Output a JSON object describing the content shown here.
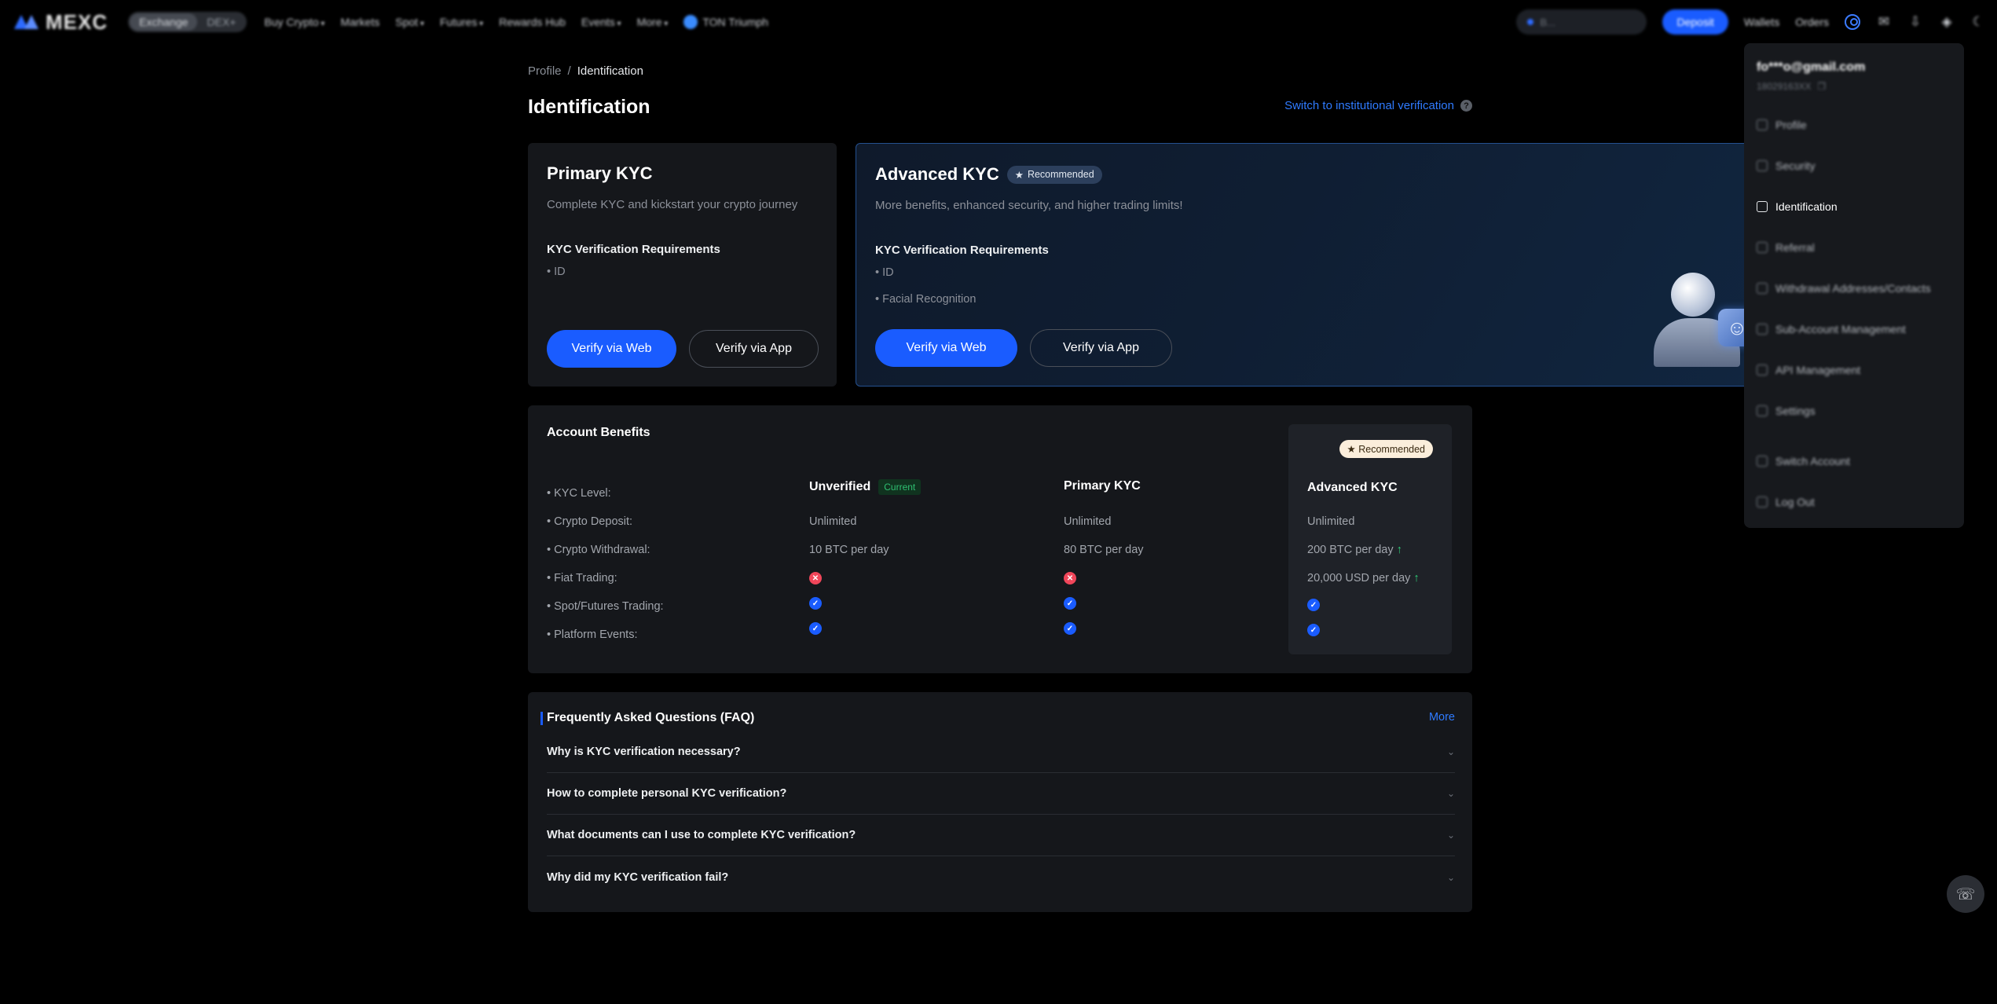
{
  "nav": {
    "logo": "MEXC",
    "segments": [
      "Exchange",
      "DEX+"
    ],
    "items": [
      "Buy Crypto",
      "Markets",
      "Spot",
      "Futures",
      "Rewards Hub",
      "Events",
      "More"
    ],
    "ton": "TON Triumph",
    "search_placeholder": "B...",
    "deposit": "Deposit",
    "wallets": "Wallets",
    "orders": "Orders"
  },
  "breadcrumb": {
    "parent": "Profile",
    "separator": "/",
    "current": "Identification"
  },
  "page_title": "Identification",
  "institutional_link": "Switch to institutional verification",
  "primary": {
    "title": "Primary KYC",
    "desc": "Complete KYC and kickstart your crypto journey",
    "req_title": "KYC Verification Requirements",
    "reqs": [
      "• ID"
    ],
    "verify_web": "Verify via Web",
    "verify_app": "Verify via App"
  },
  "advanced": {
    "title": "Advanced KYC",
    "badge": "Recommended",
    "desc": "More benefits, enhanced security, and higher trading limits!",
    "req_title": "KYC Verification Requirements",
    "reqs": [
      "• ID",
      "• Facial Recognition"
    ],
    "verify_web": "Verify via Web",
    "verify_app": "Verify via App"
  },
  "benefits": {
    "title": "Account Benefits",
    "rows": [
      "• KYC Level:",
      "• Crypto Deposit:",
      "• Crypto Withdrawal:",
      "• Fiat Trading:",
      "• Spot/Futures Trading:",
      "• Platform Events:"
    ],
    "unverified": {
      "title": "Unverified",
      "current": "Current",
      "deposit": "Unlimited",
      "withdrawal": "10 BTC per day",
      "fiat": "x",
      "spot": "check",
      "events": "check"
    },
    "primary": {
      "title": "Primary KYC",
      "deposit": "Unlimited",
      "withdrawal": "80 BTC per day",
      "fiat": "x",
      "spot": "check",
      "events": "check"
    },
    "advanced": {
      "badge": "Recommended",
      "title": "Advanced KYC",
      "deposit": "Unlimited",
      "withdrawal": "200 BTC per day",
      "fiat": "20,000 USD per day",
      "spot": "check",
      "events": "check"
    }
  },
  "faq": {
    "title": "Frequently Asked Questions (FAQ)",
    "more": "More",
    "questions": [
      "Why is KYC verification necessary?",
      "How to complete personal KYC verification?",
      "What documents can I use to complete KYC verification?",
      "Why did my KYC verification fail?"
    ]
  },
  "menu": {
    "email": "fo***o@gmail.com",
    "uid": "18029163XX",
    "items": [
      "Profile",
      "Security",
      "Identification",
      "Referral",
      "Withdrawal Addresses/Contacts",
      "Sub-Account Management",
      "API Management",
      "Settings",
      "Switch Account",
      "Log Out"
    ],
    "active": "Identification"
  },
  "colors": {
    "accent": "#1a5cff",
    "link": "#2f7bff",
    "success": "#2fbf71",
    "danger": "#f0465a"
  },
  "icons": [
    "logo-icon",
    "search-icon",
    "user-icon",
    "bell-icon",
    "download-icon",
    "globe-icon",
    "theme-icon",
    "help-icon",
    "star-icon",
    "check-icon",
    "x-icon",
    "arrow-up-icon",
    "chevron-down-icon",
    "support-icon"
  ]
}
